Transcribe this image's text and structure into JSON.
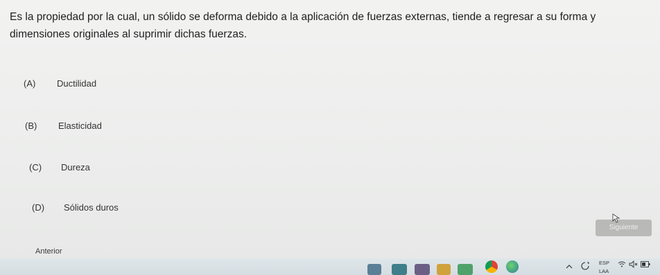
{
  "question": {
    "text": "Es la propiedad por la cual, un sólido se deforma debido a la aplicación de fuerzas externas, tiende a regresar a su forma y dimensiones originales al suprimir dichas fuerzas."
  },
  "options": [
    {
      "letter": "(A)",
      "text": "Ductilidad"
    },
    {
      "letter": "(B)",
      "text": "Elasticidad"
    },
    {
      "letter": "(C)",
      "text": "Dureza"
    },
    {
      "letter": "(D)",
      "text": "Sólidos duros"
    }
  ],
  "navigation": {
    "next_label": "Siguiente",
    "prev_label": "Anterior"
  },
  "taskbar": {
    "lang_top": "ESP",
    "lang_bottom": "LAA",
    "icons": [
      "app-icon",
      "chrome-icon",
      "edge-icon",
      "chevron-up-icon",
      "touch-keyboard-icon",
      "wifi-icon",
      "volume-muted-icon",
      "battery-icon"
    ]
  },
  "colors": {
    "page_background": "#eeefee",
    "next_button": "#b9b9b8",
    "taskbar": "#d9e1e5"
  }
}
